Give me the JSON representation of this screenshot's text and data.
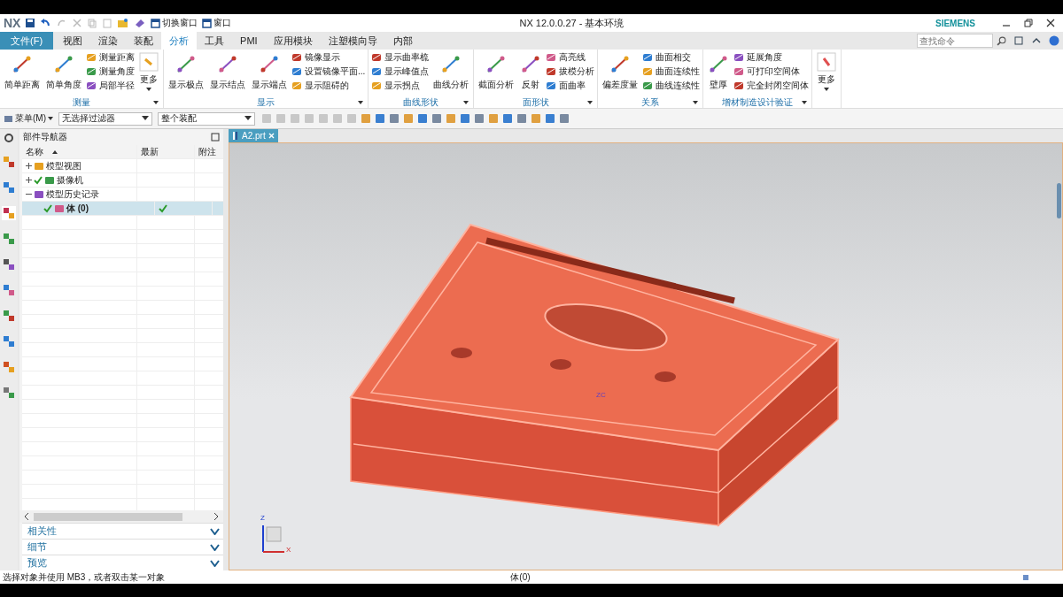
{
  "window": {
    "logo": "NX",
    "title": "NX 12.0.0.27 - 基本环境",
    "brand": "SIEMENS",
    "quick_access": [
      "切换窗口",
      "窗口"
    ]
  },
  "tabs": [
    {
      "label": "文件(F)",
      "kind": "file",
      "selected": false
    },
    {
      "label": "视图",
      "kind": "tab",
      "selected": false
    },
    {
      "label": "渲染",
      "kind": "tab",
      "selected": false
    },
    {
      "label": "装配",
      "kind": "tab",
      "selected": false
    },
    {
      "label": "分析",
      "kind": "tab",
      "selected": true
    },
    {
      "label": "工具",
      "kind": "tab",
      "selected": false
    },
    {
      "label": "PMI",
      "kind": "tab",
      "selected": false
    },
    {
      "label": "应用模块",
      "kind": "tab",
      "selected": false
    },
    {
      "label": "注塑模向导",
      "kind": "tab",
      "selected": false
    },
    {
      "label": "内部",
      "kind": "tab",
      "selected": false
    }
  ],
  "search": {
    "placeholder": "查找命令"
  },
  "ribbon": {
    "groups": [
      {
        "label": "测量",
        "items": [
          {
            "kind": "large",
            "labels": [
              "简单距离"
            ]
          },
          {
            "kind": "large",
            "labels": [
              "简单角度"
            ]
          },
          {
            "kind": "stack",
            "labels": [
              "测量距离",
              "测量角度",
              "局部半径"
            ]
          },
          {
            "kind": "more",
            "labels": [
              "更多"
            ]
          }
        ]
      },
      {
        "label": "显示",
        "items": [
          {
            "kind": "large",
            "labels": [
              "显示极点"
            ]
          },
          {
            "kind": "large",
            "labels": [
              "显示结点"
            ]
          },
          {
            "kind": "large",
            "labels": [
              "显示端点"
            ]
          },
          {
            "kind": "stack",
            "labels": [
              "镜像显示",
              "设置镜像平面...",
              "显示阻碍的"
            ]
          }
        ]
      },
      {
        "label": "曲线形状",
        "items": [
          {
            "kind": "stack",
            "labels": [
              "显示曲率梳",
              "显示峰值点",
              "显示拐点"
            ]
          },
          {
            "kind": "large",
            "labels": [
              "曲线分析"
            ]
          }
        ]
      },
      {
        "label": "面形状",
        "items": [
          {
            "kind": "large",
            "labels": [
              "截面分析"
            ]
          },
          {
            "kind": "large",
            "labels": [
              "反射"
            ]
          },
          {
            "kind": "stack",
            "labels": [
              "高亮线",
              "拔模分析",
              "面曲率"
            ]
          }
        ]
      },
      {
        "label": "关系",
        "items": [
          {
            "kind": "large",
            "labels": [
              "偏差度量"
            ]
          },
          {
            "kind": "stack",
            "labels": [
              "曲面相交",
              "曲面连续性",
              "曲线连续性"
            ]
          }
        ]
      },
      {
        "label": "增材制造设计验证",
        "items": [
          {
            "kind": "large",
            "labels": [
              "壁厚"
            ]
          },
          {
            "kind": "stack",
            "labels": [
              "延展角度",
              "可打印空间体",
              "完全封闭空间体"
            ]
          }
        ]
      }
    ],
    "more": "更多"
  },
  "toolbar": {
    "menu": "菜单(M)",
    "filter": "无选择过滤器",
    "scope": "整个装配"
  },
  "navigator": {
    "title": "部件导航器",
    "columns": [
      "名称",
      "最新",
      "附注"
    ],
    "tree": [
      {
        "label": "模型视图",
        "expanded": false,
        "checked": false,
        "latest": false,
        "selected": false
      },
      {
        "label": "摄像机",
        "expanded": false,
        "checked": true,
        "latest": false,
        "selected": false
      },
      {
        "label": "模型历史记录",
        "expanded": true,
        "checked": false,
        "latest": false,
        "selected": false,
        "children": [
          {
            "label": "体 (0)",
            "checked": true,
            "latest": true,
            "selected": true
          }
        ]
      }
    ],
    "panels": [
      {
        "label": "相关性",
        "expanded": false
      },
      {
        "label": "细节",
        "expanded": false
      },
      {
        "label": "预览",
        "expanded": false
      }
    ]
  },
  "document_tab": "A2.prt",
  "viewport": {
    "csys_label": "ZC",
    "triad": [
      "Z",
      "X"
    ]
  },
  "status_bar": {
    "prompt": "选择对象并使用 MB3，或者双击某一对象",
    "selection": "体(0)"
  }
}
